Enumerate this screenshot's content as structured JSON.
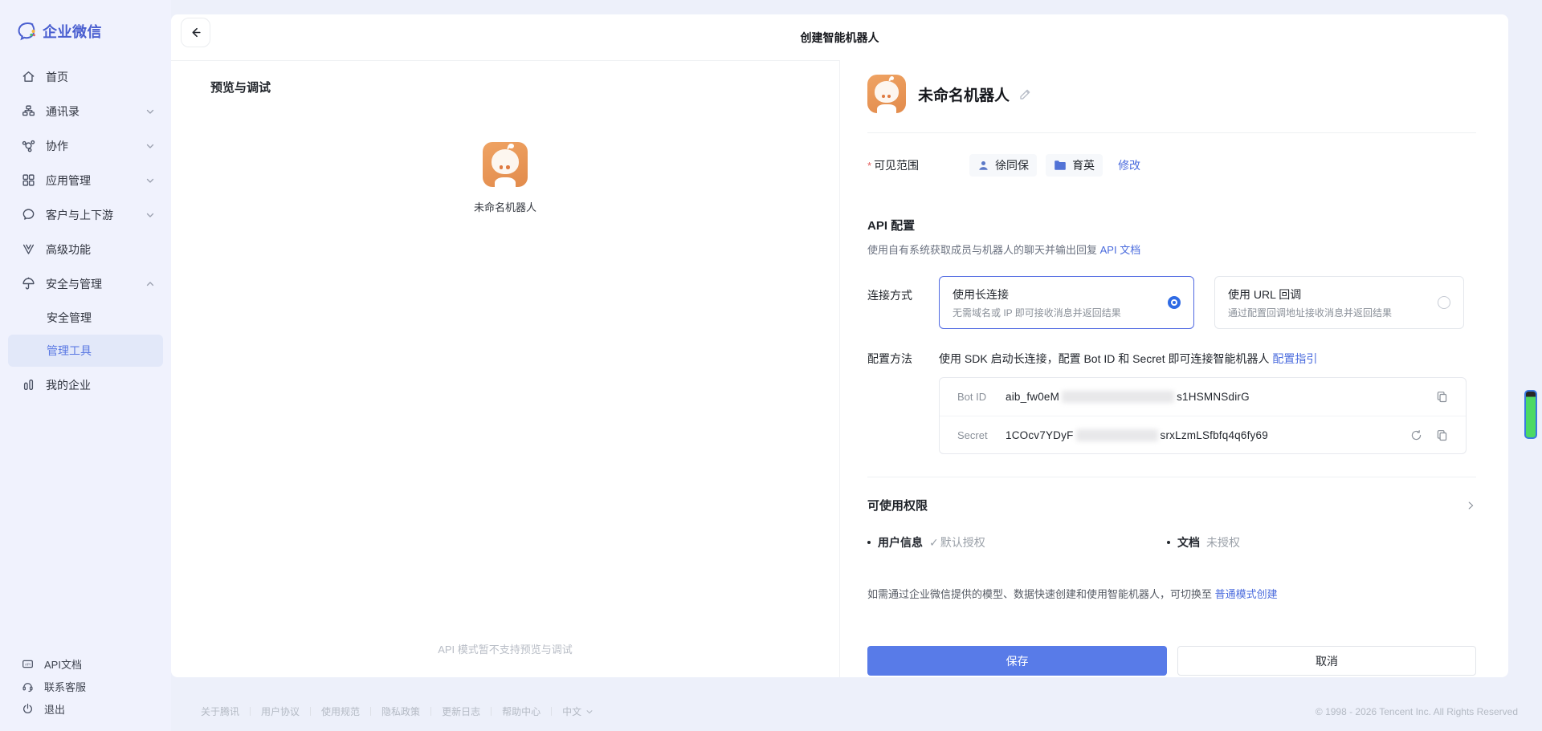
{
  "sidebar": {
    "logo_text": "企业微信",
    "items": [
      {
        "label": "首页"
      },
      {
        "label": "通讯录"
      },
      {
        "label": "协作"
      },
      {
        "label": "应用管理"
      },
      {
        "label": "客户与上下游"
      },
      {
        "label": "高级功能"
      },
      {
        "label": "安全与管理"
      },
      {
        "label": "安全管理"
      },
      {
        "label": "管理工具"
      },
      {
        "label": "我的企业"
      }
    ],
    "bottom_items": [
      {
        "label": "API文档"
      },
      {
        "label": "联系客服"
      },
      {
        "label": "退出"
      }
    ]
  },
  "header": {
    "title": "创建智能机器人"
  },
  "preview": {
    "title": "预览与调试",
    "robot_name": "未命名机器人",
    "note": "API 模式暂不支持预览与调试"
  },
  "form": {
    "robot_name": "未命名机器人",
    "scope": {
      "required_mark": "*",
      "label": "可见范围",
      "member": "徐同保",
      "department": "育英",
      "modify_link": "修改"
    },
    "api_config": {
      "title": "API 配置",
      "desc": "使用自有系统获取成员与机器人的聊天并输出回复",
      "doc_link": "API 文档"
    },
    "connection": {
      "label": "连接方式",
      "options": [
        {
          "title": "使用长连接",
          "desc": "无需域名或 IP 即可接收消息并返回结果",
          "selected": true
        },
        {
          "title": "使用 URL 回调",
          "desc": "通过配置回调地址接收消息并返回结果",
          "selected": false
        }
      ]
    },
    "config_method": {
      "label": "配置方法",
      "desc": "使用 SDK 启动长连接，配置 Bot ID 和 Secret 即可连接智能机器人",
      "guide_link": "配置指引",
      "bot_id": {
        "label": "Bot ID",
        "value_prefix": "aib_fw0eM",
        "value_suffix": "s1HSMNSdirG"
      },
      "secret": {
        "label": "Secret",
        "value_prefix": "1COcv7YDyF",
        "value_suffix": "srxLzmLSfbfq4q6fy69"
      }
    },
    "permissions": {
      "title": "可使用权限",
      "items": [
        {
          "name": "用户信息",
          "check": "✓",
          "status": "默认授权"
        },
        {
          "name": "文档",
          "check": "",
          "status": "未授权"
        }
      ]
    },
    "switch_note": {
      "text": "如需通过企业微信提供的模型、数据快速创建和使用智能机器人，可切换至 ",
      "link": "普通模式创建"
    },
    "buttons": {
      "save": "保存",
      "cancel": "取消"
    }
  },
  "footer": {
    "links": [
      "关于腾讯",
      "用户协议",
      "使用规范",
      "隐私政策",
      "更新日志",
      "帮助中心"
    ],
    "lang": "中文",
    "copyright": "© 1998 - 2026 Tencent Inc. All Rights Reserved"
  },
  "colors": {
    "accent_blue": "#4a6bdd",
    "save_button_blue": "#587be8",
    "selected_card_border": "#5069e2",
    "radio_fill_blue": "#2f6be4",
    "avatar_orange": "#eb9c5c",
    "sidebar_selected_text": "#5b79e3",
    "sidebar_selected_bg": "#e2e8f9",
    "side_marker_green": "#4cd964"
  }
}
